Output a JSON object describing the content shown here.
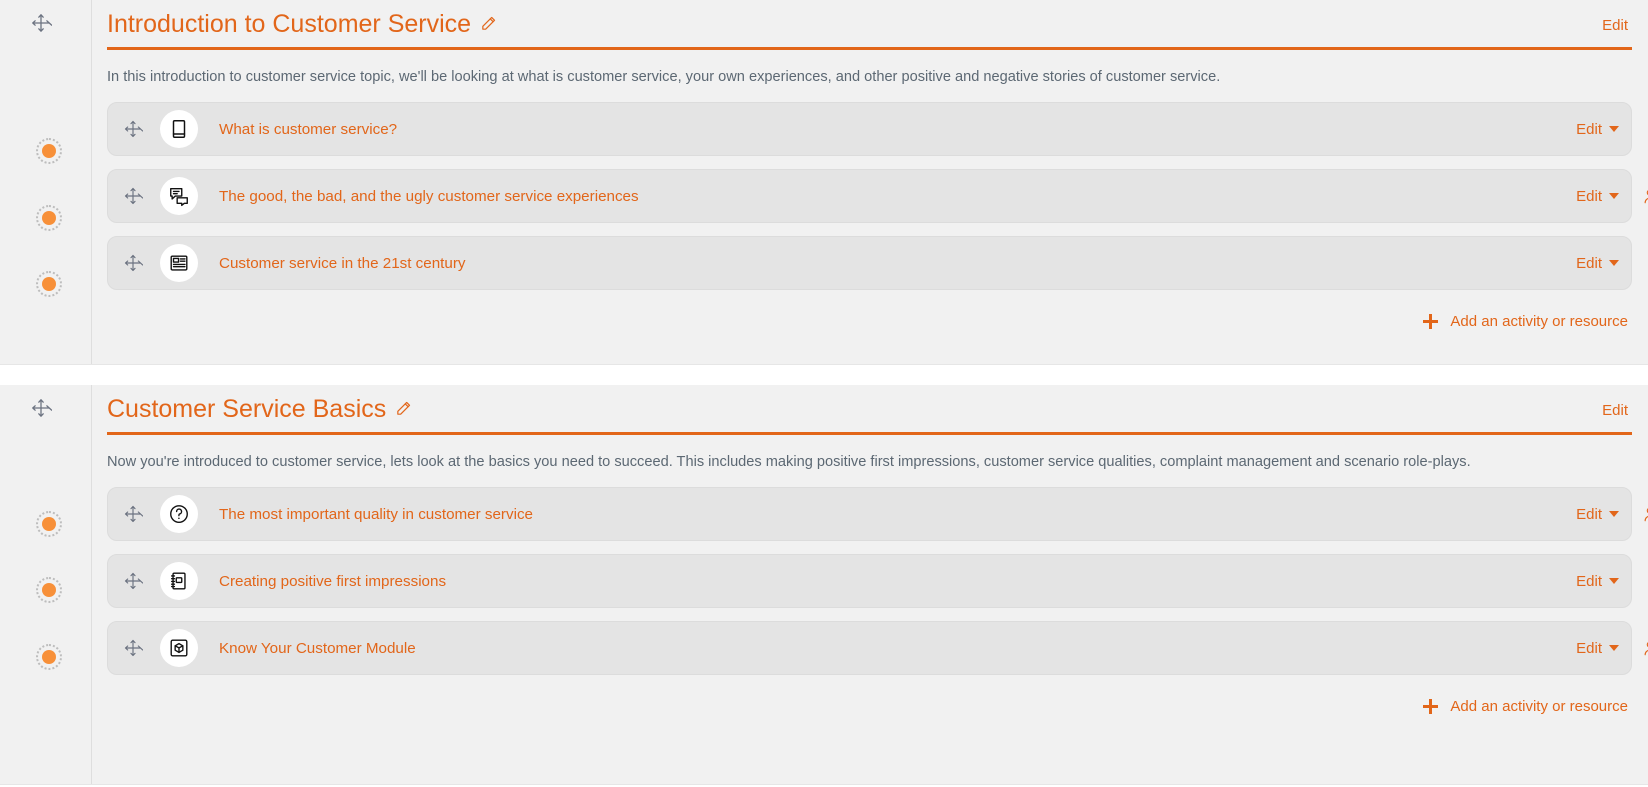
{
  "colors": {
    "accent": "#e2661a",
    "marker_fill": "#f79039",
    "section_bg": "#f1f1f1",
    "activity_bg": "#e4e4e4",
    "text_muted": "#5c6873"
  },
  "labels": {
    "section_edit": "Edit",
    "activity_edit": "Edit",
    "add_activity": "Add an activity or resource"
  },
  "sections": [
    {
      "title": "Introduction to Customer Service",
      "summary": "In this introduction to customer service topic, we'll be looking at what is customer service, your own experiences, and other positive and negative stories of customer service.",
      "edit_label": "Edit",
      "add_label": "Add an activity or resource",
      "activities": [
        {
          "name": "What is customer service?",
          "icon": "book-icon",
          "edit_label": "Edit",
          "has_group_icon": false,
          "completion": "incomplete"
        },
        {
          "name": "The good, the bad, and the ugly customer service experiences",
          "icon": "forum-icon",
          "edit_label": "Edit",
          "has_group_icon": true,
          "completion": "incomplete"
        },
        {
          "name": "Customer service in the 21st century",
          "icon": "page-icon",
          "edit_label": "Edit",
          "has_group_icon": false,
          "completion": "incomplete"
        }
      ]
    },
    {
      "title": "Customer Service Basics",
      "summary": "Now you're introduced to customer service, lets look at the basics you need to succeed. This includes making positive first impressions, customer service qualities, complaint management and scenario role-plays.",
      "edit_label": "Edit",
      "add_label": "Add an activity or resource",
      "activities": [
        {
          "name": "The most important quality in customer service",
          "icon": "quiz-question-icon",
          "edit_label": "Edit",
          "has_group_icon": true,
          "completion": "incomplete"
        },
        {
          "name": "Creating positive first impressions",
          "icon": "lesson-notebook-icon",
          "edit_label": "Edit",
          "has_group_icon": false,
          "completion": "incomplete"
        },
        {
          "name": "Know Your Customer Module",
          "icon": "scorm-cube-icon",
          "edit_label": "Edit",
          "has_group_icon": true,
          "completion": "incomplete"
        }
      ]
    }
  ]
}
